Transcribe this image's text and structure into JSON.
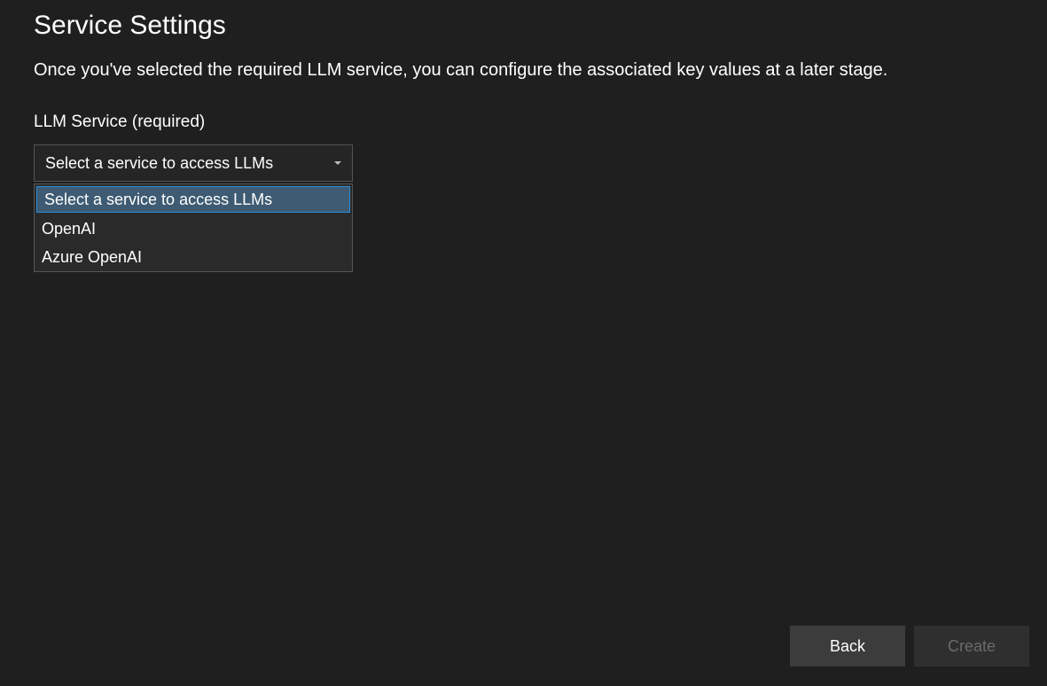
{
  "page": {
    "title": "Service Settings",
    "description": "Once you've selected the required LLM service, you can configure the associated key values at a later stage."
  },
  "form": {
    "llm_service_label": "LLM Service (required)",
    "dropdown": {
      "selected": "Select a service to access LLMs",
      "options": [
        "Select a service to access LLMs",
        "OpenAI",
        "Azure OpenAI"
      ]
    }
  },
  "footer": {
    "back_label": "Back",
    "create_label": "Create"
  }
}
